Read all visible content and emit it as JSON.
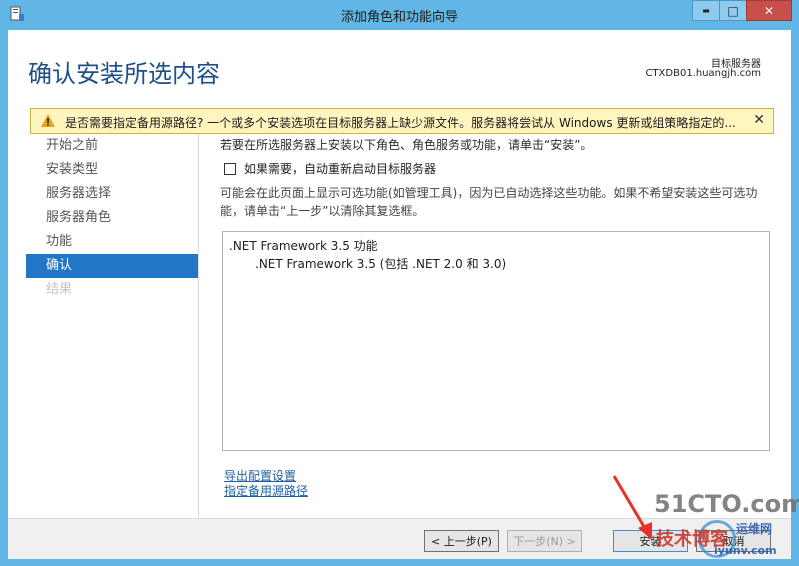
{
  "window": {
    "title": "添加角色和功能向导",
    "minimize_symbol": "▬",
    "maximize_symbol": "□",
    "close_symbol": "✕"
  },
  "header": {
    "page_title": "确认安装所选内容",
    "destination_label": "目标服务器",
    "destination_server": "CTXDB01.huangjh.com"
  },
  "warning": {
    "text": "是否需要指定备用源路径? 一个或多个安装选项在目标服务器上缺少源文件。服务器将尝试从 Windows 更新或组策略指定的...",
    "close": "✕",
    "icon": "warning-icon"
  },
  "nav": {
    "items": [
      {
        "label": "开始之前",
        "state": "normal"
      },
      {
        "label": "安装类型",
        "state": "normal"
      },
      {
        "label": "服务器选择",
        "state": "normal"
      },
      {
        "label": "服务器角色",
        "state": "normal"
      },
      {
        "label": "功能",
        "state": "normal"
      },
      {
        "label": "确认",
        "state": "selected"
      },
      {
        "label": "结果",
        "state": "disabled"
      }
    ]
  },
  "content": {
    "intro": "若要在所选服务器上安装以下角色、角色服务或功能，请单击“安装”。",
    "restart_checkbox": {
      "label": "如果需要，自动重新启动目标服务器",
      "checked": false
    },
    "note": "可能会在此页面上显示可选功能(如管理工具)，因为已自动选择这些功能。如果不希望安装这些可选功能，请单击“上一步”以清除其复选框。",
    "features": [
      {
        "label": ".NET Framework 3.5 功能",
        "level": 0
      },
      {
        "label": ".NET Framework 3.5 (包括 .NET 2.0 和 3.0)",
        "level": 1
      }
    ],
    "links": {
      "export": "导出配置设置",
      "alternate_source": "指定备用源路径"
    }
  },
  "footer": {
    "previous": "< 上一步(P)",
    "next": "下一步(N) >",
    "install": "安装",
    "cancel": "取消"
  },
  "watermark": {
    "line1": "51CTO.com",
    "line2": "技术博客",
    "line3": "运维网",
    "line4": "iyunv.com"
  },
  "colors": {
    "window_frame": "#62b6e6",
    "accent": "#2276c6",
    "title_text": "#1e4f8a",
    "warning_bg": "#fff6bf",
    "link": "#1e5fa8"
  }
}
